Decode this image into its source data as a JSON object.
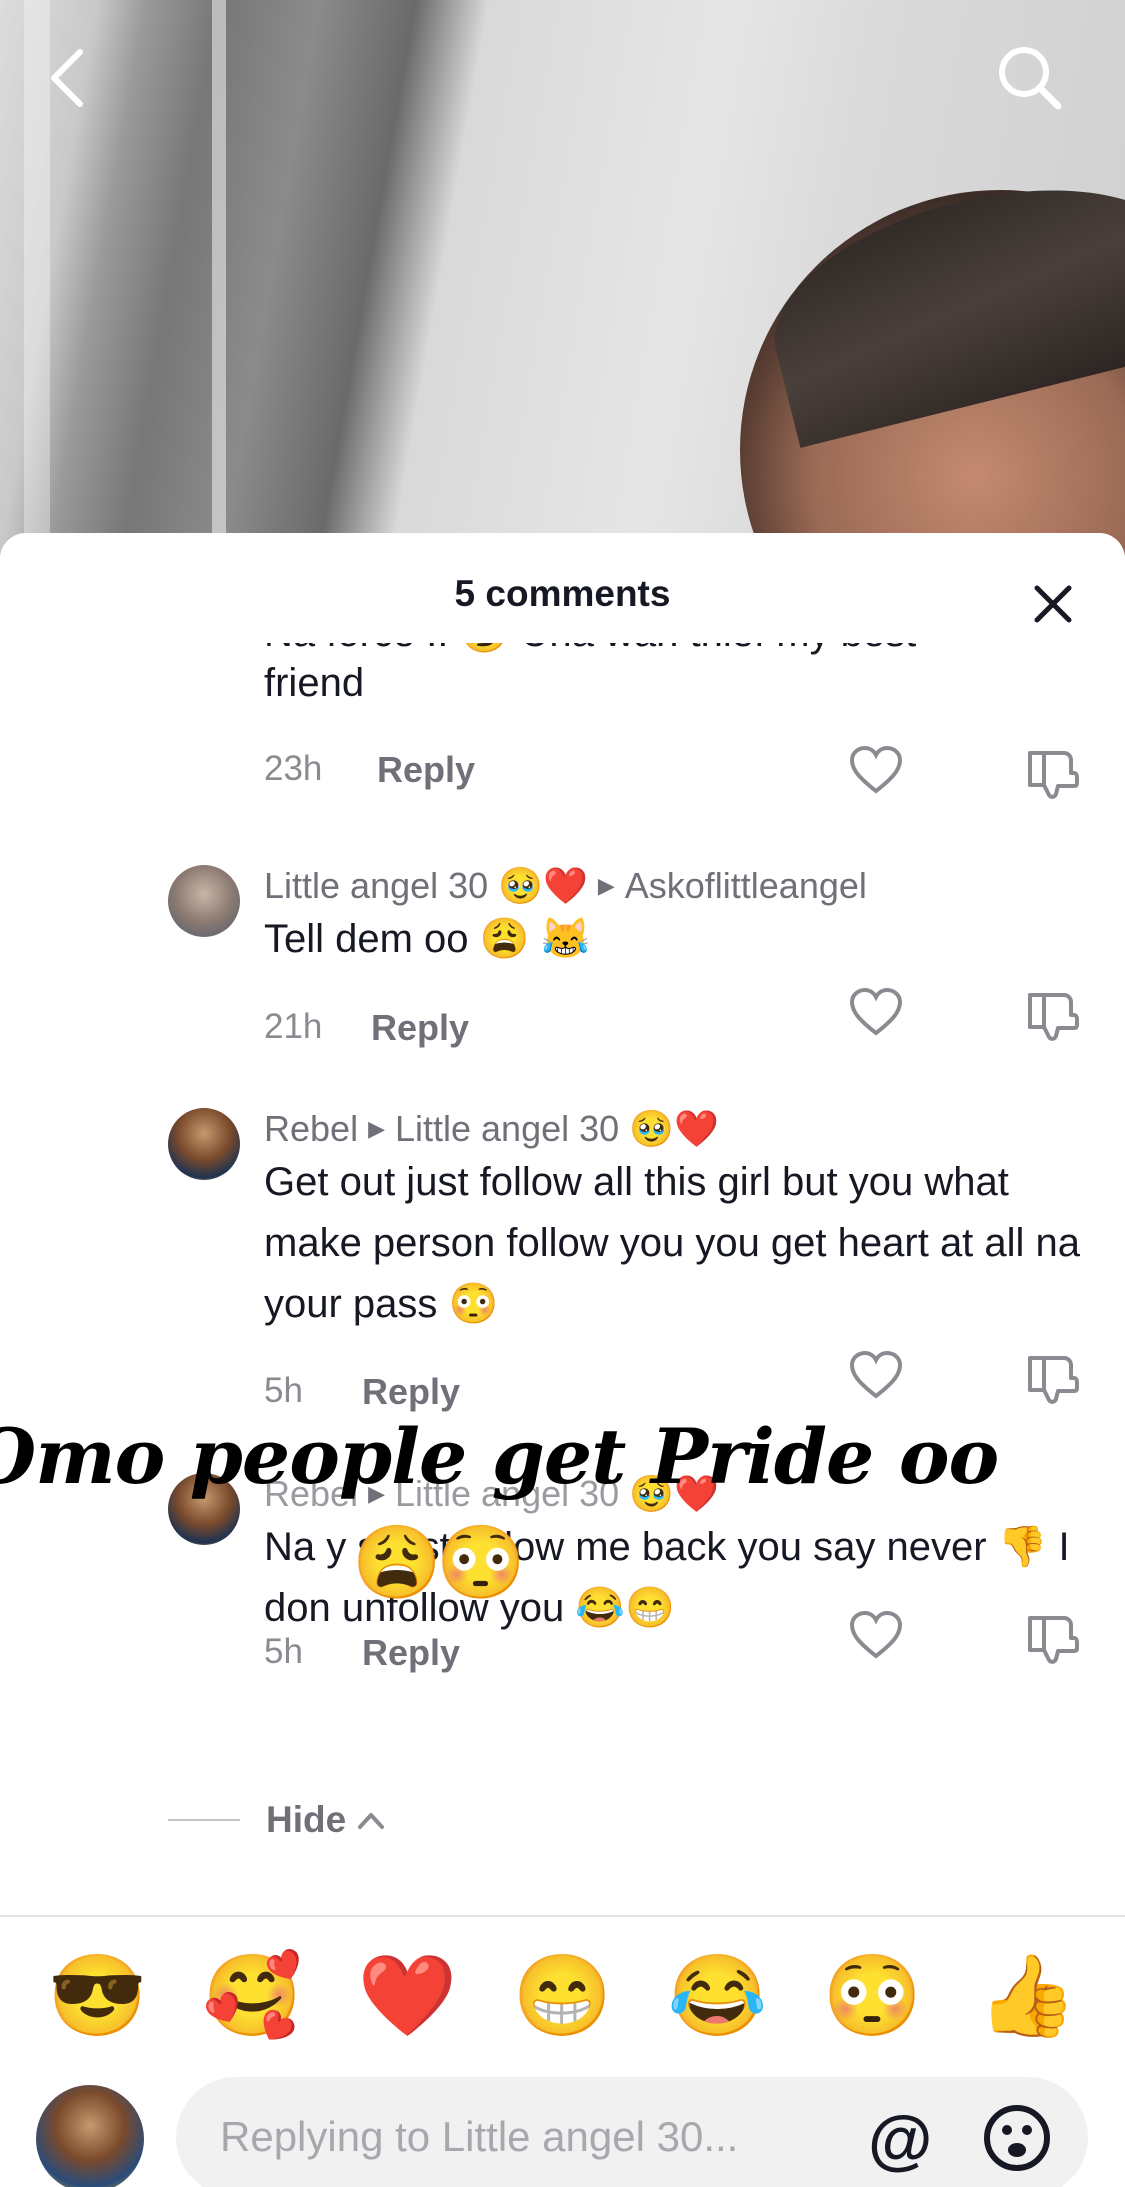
{
  "header": {
    "comment_count_label": "5 comments"
  },
  "comments": [
    {
      "text_line_partial": "Na force !! 😏 Una wan thief my best",
      "text_line": "friend",
      "age": "23h",
      "reply_label": "Reply"
    },
    {
      "author": "Little angel 30 🥹❤️",
      "reply_to": "Askoflittleangel",
      "text": "Tell dem oo 😩 😹",
      "age": "21h",
      "reply_label": "Reply"
    },
    {
      "author": "Rebel",
      "reply_to": "Little angel 30 🥹❤️",
      "text": "Get out just follow all this girl but you what make person follow you you get heart at all na your pass 😳",
      "age": "5h",
      "reply_label": "Reply"
    },
    {
      "author": "Rebel",
      "reply_to": "Little angel 30 🥹❤️",
      "text": "Na y s just follow me back you say never 👎 I don unfollow you 😂😁",
      "age": "5h",
      "reply_label": "Reply"
    }
  ],
  "hide_label": "Hide",
  "overlay": {
    "caption": "Omo people get Pride oo",
    "emoji_1": "😩",
    "emoji_2": "😳"
  },
  "quick_emojis": [
    "😎",
    "🥰",
    "❤️",
    "😁",
    "😂",
    "😳",
    "👍"
  ],
  "composer": {
    "placeholder": "Replying to Little angel 30...",
    "mention_symbol": "@"
  }
}
